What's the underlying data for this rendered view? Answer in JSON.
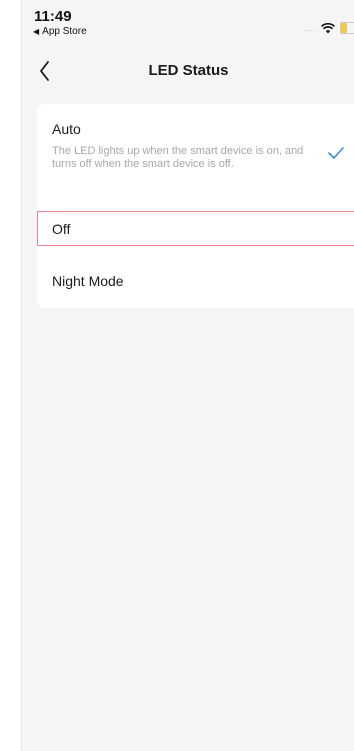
{
  "status_bar": {
    "time": "11:49",
    "back_app_label": "App Store",
    "signal_dots": "....",
    "icons": [
      "wifi-icon",
      "battery-icon"
    ],
    "battery_color": "#f2c94c"
  },
  "nav": {
    "back_icon": "chevron-left-icon",
    "title": "LED Status"
  },
  "options": [
    {
      "label": "Auto",
      "description": "The LED lights up when the smart device is on, and turns off when the smart device is off.",
      "selected": true,
      "check_icon": "checkmark-icon"
    },
    {
      "label": "Off",
      "selected": false,
      "highlighted": true
    },
    {
      "label": "Night Mode",
      "selected": false
    }
  ],
  "colors": {
    "accent": "#3b8fd9",
    "highlight_border": "#ea8a8a",
    "background": "#f5f5f7",
    "card": "#ffffff",
    "muted_text": "#a7a7ad"
  }
}
